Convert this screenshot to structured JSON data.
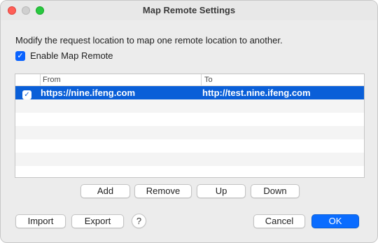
{
  "window": {
    "title": "Map Remote Settings"
  },
  "description": "Modify the request location to map one remote location to another.",
  "enable": {
    "label": "Enable Map Remote",
    "checked": true
  },
  "table": {
    "columns": {
      "check": "",
      "from": "From",
      "to": "To"
    },
    "rows": [
      {
        "checked": true,
        "from": "https://nine.ifeng.com",
        "to": "http://test.nine.ifeng.com",
        "selected": true
      }
    ]
  },
  "buttons": {
    "add": "Add",
    "remove": "Remove",
    "up": "Up",
    "down": "Down",
    "import": "Import",
    "export": "Export",
    "help": "?",
    "cancel": "Cancel",
    "ok": "OK"
  },
  "colors": {
    "accent": "#0a6cff",
    "selection": "#0a5fd8",
    "close": "#ff5f57",
    "zoom": "#28c840"
  }
}
